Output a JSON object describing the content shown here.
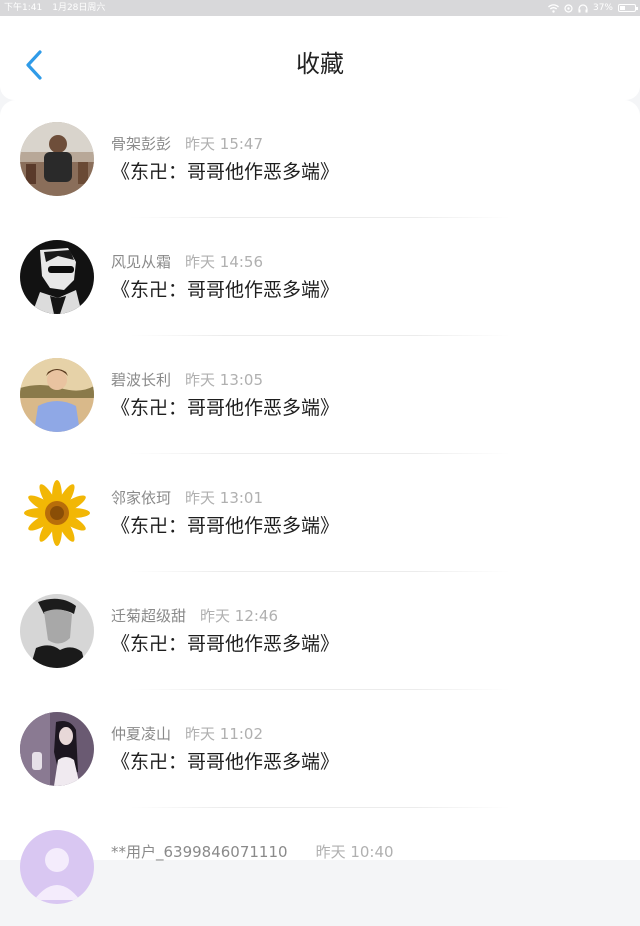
{
  "status_bar": {
    "time": "下午1:41",
    "date": "1月28日周六",
    "battery": "37%",
    "battery_level": 0.37,
    "icons": [
      "wifi-icon",
      "location-icon",
      "headphones-icon",
      "battery-icon"
    ]
  },
  "header": {
    "back_icon": "chevron-left-icon",
    "title": "收藏"
  },
  "colors": {
    "accent": "#2f9be8",
    "title_text": "#1e1e1e",
    "meta_text": "#8a8a8a",
    "time_text": "#b0b0b0"
  },
  "items": [
    {
      "user": "骨架彭彭",
      "time": "昨天 15:47",
      "title": "《东卍：哥哥他作恶多端》",
      "avatar": "man-photo-avatar"
    },
    {
      "user": "风见从霜",
      "time": "昨天 14:56",
      "title": "《东卍：哥哥他作恶多端》",
      "avatar": "sketch-portrait-avatar"
    },
    {
      "user": "碧波长利",
      "time": "昨天 13:05",
      "title": "《东卍：哥哥他作恶多端》",
      "avatar": "boy-outdoor-avatar"
    },
    {
      "user": "邻家依珂",
      "time": "昨天 13:01",
      "title": "《东卍：哥哥他作恶多端》",
      "avatar": "sunflower-avatar"
    },
    {
      "user": "迁菊超级甜",
      "time": "昨天 12:46",
      "title": "《东卍：哥哥他作恶多端》",
      "avatar": "bw-portrait-avatar"
    },
    {
      "user": "仲夏凌山",
      "time": "昨天 11:02",
      "title": "《东卍：哥哥他作恶多端》",
      "avatar": "girl-photo-avatar"
    },
    {
      "user": "**用户_6399846071110",
      "time": "昨天 10:40",
      "title": "",
      "avatar": "default-avatar"
    }
  ]
}
